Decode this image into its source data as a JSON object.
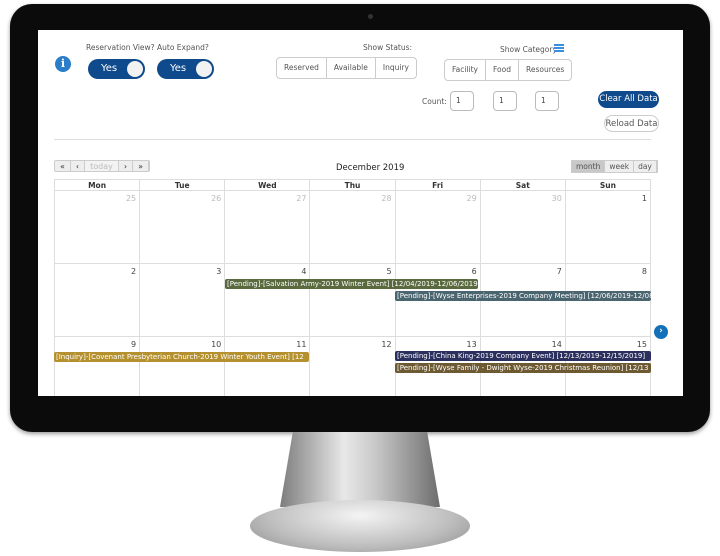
{
  "toggles": [
    {
      "label": "Reservation View?",
      "value": "Yes"
    },
    {
      "label": "Auto Expand?",
      "value": "Yes"
    }
  ],
  "status": {
    "label": "Show Status:",
    "options": [
      "Reserved",
      "Available",
      "Inquiry"
    ]
  },
  "category": {
    "label": "Show Category:",
    "options": [
      "Facility",
      "Food",
      "Resources"
    ]
  },
  "count": {
    "label": "Count:",
    "values": [
      "1",
      "1",
      "1"
    ]
  },
  "buttons": {
    "clear": "Clear All Data",
    "reload": "Reload Data"
  },
  "calendar": {
    "title": "December 2019",
    "nav": [
      "«",
      "‹",
      "today",
      "›",
      "»"
    ],
    "views": [
      "month",
      "week",
      "day"
    ],
    "active_view": "month",
    "weekdays": [
      "Mon",
      "Tue",
      "Wed",
      "Thu",
      "Fri",
      "Sat",
      "Sun"
    ],
    "weeks": [
      [
        "25",
        "26",
        "27",
        "28",
        "29",
        "30",
        "1"
      ],
      [
        "2",
        "3",
        "4",
        "5",
        "6",
        "7",
        "8"
      ],
      [
        "9",
        "10",
        "11",
        "12",
        "13",
        "14",
        "15"
      ]
    ],
    "events": [
      {
        "text": "[Pending]-[Salvation Army-2019 Winter Event] [12/04/2019-12/06/2019]",
        "color": "#5a6a3e"
      },
      {
        "text": "[Pending]-[Wyse Enterprises-2019 Company Meeting] [12/06/2019-12/08/2019]",
        "color": "#4a6570"
      },
      {
        "text": "[Inquiry]-[Covenant Presbyterian Church-2019 Winter Youth Event] [12",
        "color": "#b5902e"
      },
      {
        "text": "[Pending]-[China King-2019 Company Event] [12/13/2019-12/15/2019]",
        "color": "#2b2f5e"
      },
      {
        "text": "[Pending]-[Wyse Family - Dwight Wyse-2019 Christmas Reunion] [12/13",
        "color": "#6e5a32"
      }
    ]
  },
  "colors": {
    "accent": "#0e4a8c"
  }
}
